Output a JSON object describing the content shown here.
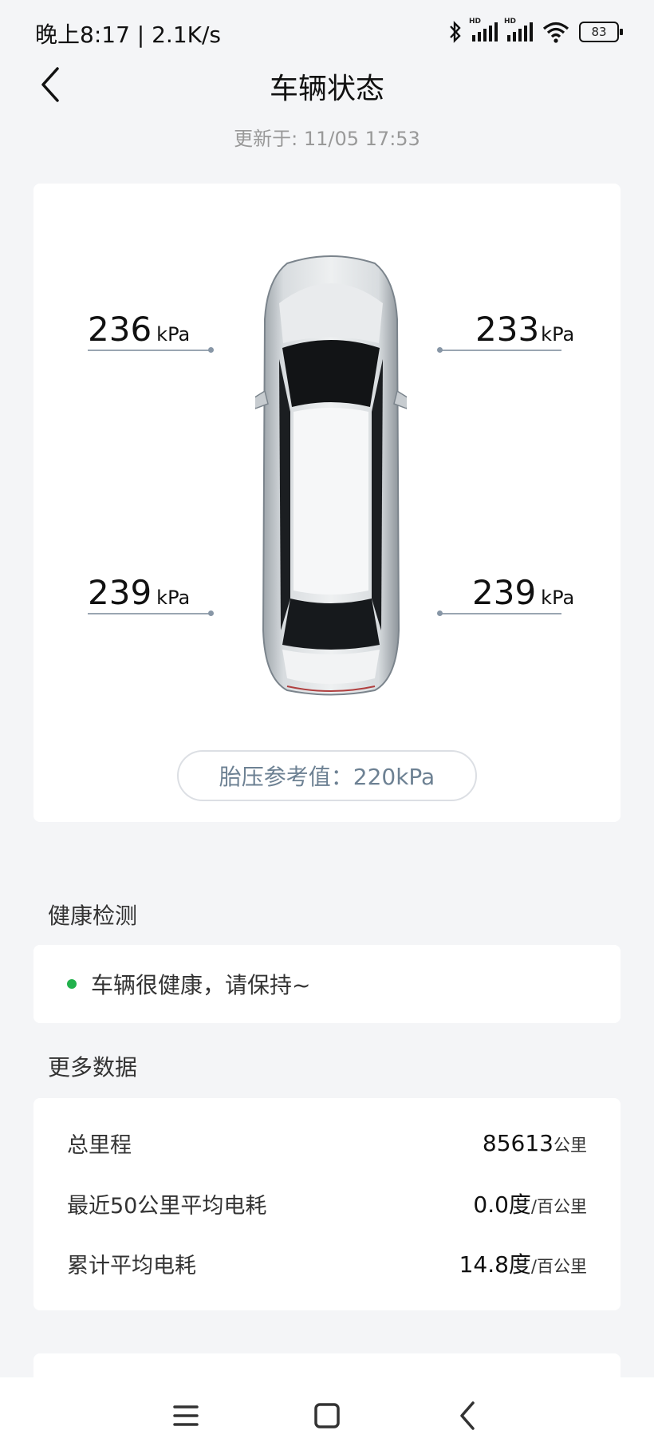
{
  "status_bar": {
    "time": "晚上8:17 | 2.1K/s",
    "battery": "83",
    "hd_label": "HD"
  },
  "header": {
    "title": "车辆状态",
    "updated": "更新于: 11/05 17:53"
  },
  "tires": {
    "front_left": "236",
    "front_right": "233",
    "rear_left": "239",
    "rear_right": "239",
    "unit": "kPa",
    "reference": "胎压参考值：220kPa"
  },
  "health": {
    "section_title": "健康检测",
    "status": "车辆很健康，请保持~",
    "status_color": "#22b14c"
  },
  "more_data": {
    "section_title": "更多数据",
    "rows": [
      {
        "label": "总里程",
        "value": "85613",
        "unit": "公里"
      },
      {
        "label": "最近50公里平均电耗",
        "value": "0.0度",
        "unit": "/百公里"
      },
      {
        "label": "累计平均电耗",
        "value": "14.8度",
        "unit": "/百公里"
      }
    ]
  },
  "nav_icons": [
    "menu-icon",
    "home-icon",
    "back-icon"
  ]
}
